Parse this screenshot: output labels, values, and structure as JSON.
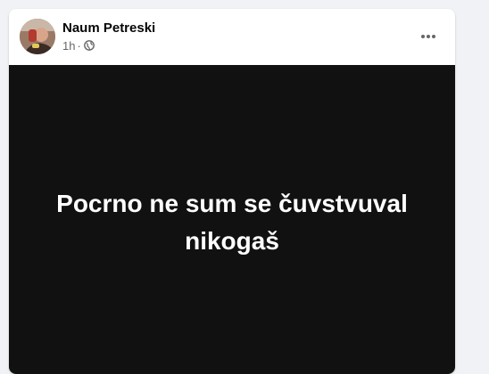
{
  "post": {
    "author_name": "Naum Petreski",
    "time": "1h",
    "separator": "·",
    "privacy_icon": "globe-icon",
    "more_icon": "more-options-icon",
    "image_text": "Pocrno ne sum se čuvstvuval nikogaš"
  },
  "colors": {
    "page_background": "#f0f2f5",
    "card_background": "#ffffff",
    "image_background": "#111111",
    "image_text": "#ffffff",
    "name_text": "#050505",
    "meta_text": "#65676b"
  }
}
